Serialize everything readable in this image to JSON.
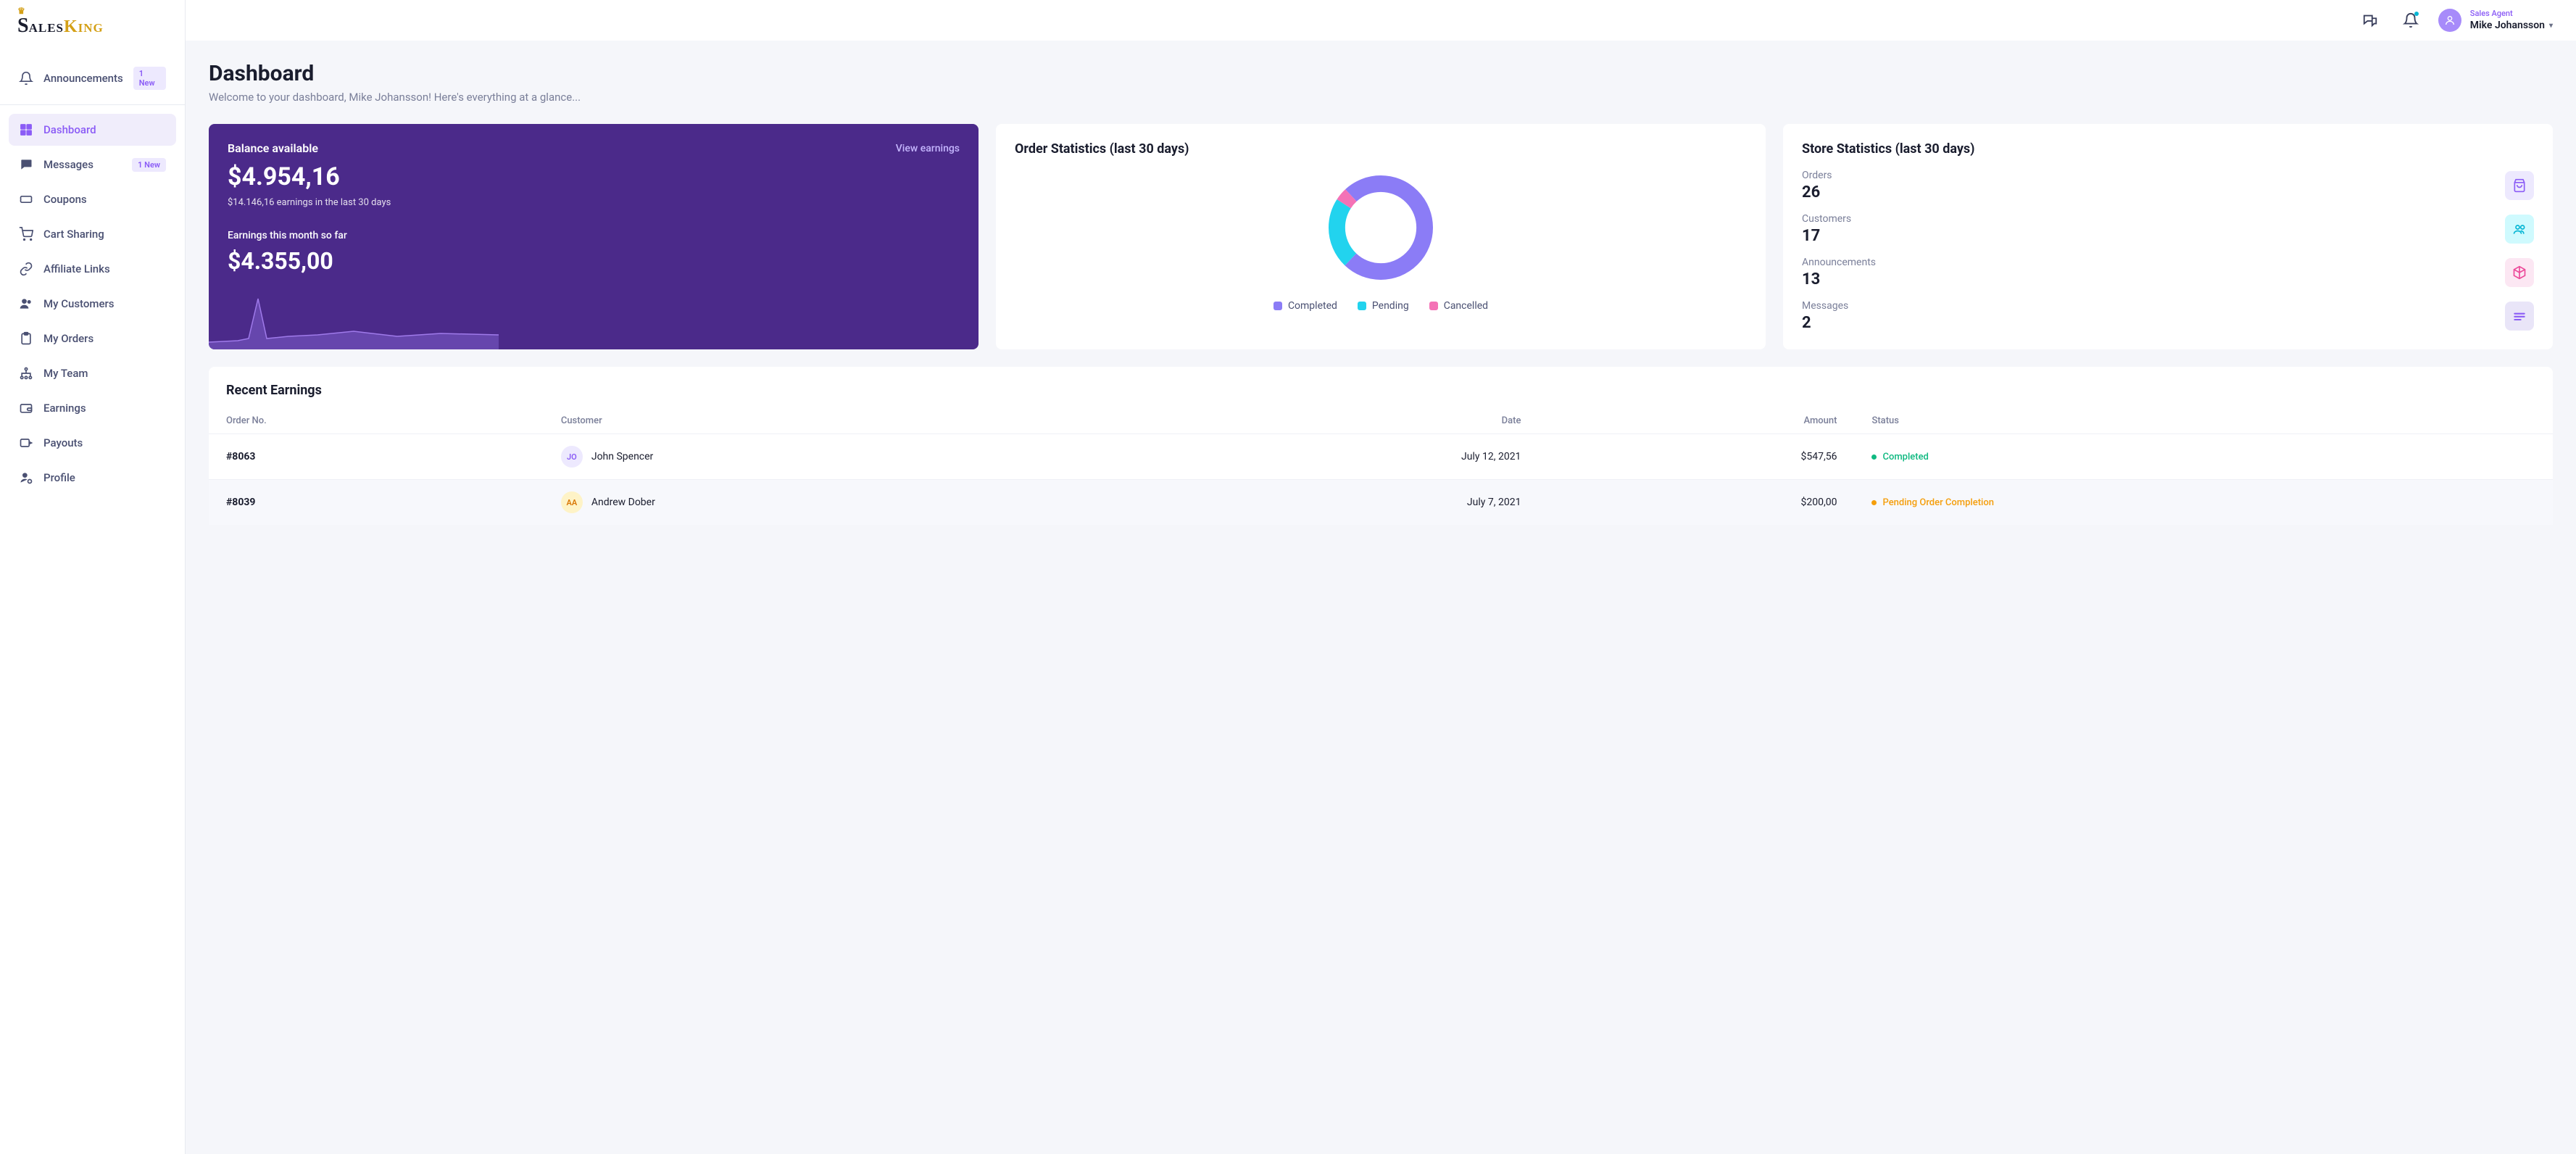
{
  "brand": {
    "part1": "S",
    "part2": "ales",
    "part3": "King"
  },
  "header": {
    "role": "Sales Agent",
    "user_name": "Mike Johansson"
  },
  "sidebar": {
    "items": [
      {
        "label": "Announcements",
        "badge": "1 New"
      },
      {
        "label": "Dashboard"
      },
      {
        "label": "Messages",
        "badge": "1 New"
      },
      {
        "label": "Coupons"
      },
      {
        "label": "Cart Sharing"
      },
      {
        "label": "Affiliate Links"
      },
      {
        "label": "My Customers"
      },
      {
        "label": "My Orders"
      },
      {
        "label": "My Team"
      },
      {
        "label": "Earnings"
      },
      {
        "label": "Payouts"
      },
      {
        "label": "Profile"
      }
    ]
  },
  "page": {
    "title": "Dashboard",
    "subtitle": "Welcome to your dashboard, Mike Johansson! Here's everything at a glance..."
  },
  "balance": {
    "label": "Balance available",
    "view_link": "View earnings",
    "amount": "$4.954,16",
    "subtext": "$14.146,16 earnings in the last 30 days",
    "month_label": "Earnings this month so far",
    "month_amount": "$4.355,00"
  },
  "order_stats": {
    "title": "Order Statistics (last 30 days)",
    "legend": {
      "completed": "Completed",
      "pending": "Pending",
      "cancelled": "Cancelled"
    }
  },
  "chart_data": {
    "type": "pie",
    "title": "Order Statistics (last 30 days)",
    "series": [
      {
        "name": "Completed",
        "value": 74,
        "color": "#8b7cf6"
      },
      {
        "name": "Pending",
        "value": 22,
        "color": "#22d3ee"
      },
      {
        "name": "Cancelled",
        "value": 4,
        "color": "#f472b6"
      }
    ],
    "note": "values are estimated percentages read from donut arc lengths"
  },
  "store_stats": {
    "title": "Store Statistics (last 30 days)",
    "items": [
      {
        "label": "Orders",
        "value": "26"
      },
      {
        "label": "Customers",
        "value": "17"
      },
      {
        "label": "Announcements",
        "value": "13"
      },
      {
        "label": "Messages",
        "value": "2"
      }
    ]
  },
  "recent": {
    "title": "Recent Earnings",
    "columns": {
      "order": "Order No.",
      "customer": "Customer",
      "date": "Date",
      "amount": "Amount",
      "status": "Status"
    },
    "rows": [
      {
        "order_no": "#8063",
        "initials": "JO",
        "customer": "John Spencer",
        "date": "July 12, 2021",
        "amount": "$547,56",
        "status": "Completed"
      },
      {
        "order_no": "#8039",
        "initials": "AA",
        "customer": "Andrew Dober",
        "date": "July 7, 2021",
        "amount": "$200,00",
        "status": "Pending Order Completion"
      }
    ]
  }
}
